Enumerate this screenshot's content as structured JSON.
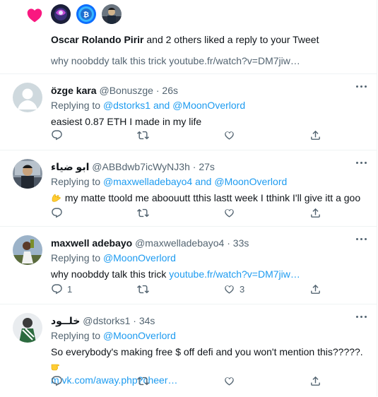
{
  "notification": {
    "actor": "Oscar Rolando Pirir",
    "action": "and 2 others liked a reply to your Tweet",
    "preview": "why  noobddy talk  this trick youtube.fr/watch?v=DM7jiw…"
  },
  "tweets": [
    {
      "name": "özge kara",
      "handle": "@Bonuszge",
      "sep": "·",
      "time": "26s",
      "reply_prefix": "Replying to ",
      "reply_to": "@dstorks1 and @MoonOverlord",
      "text": "easiest 0.87 ETH I made in my life",
      "reply_count": "",
      "like_count": ""
    },
    {
      "name": "ابو ضياء",
      "handle": "@ABBdwb7icWyNJ3h",
      "sep": "·",
      "time": "27s",
      "reply_prefix": "Replying to ",
      "reply_to": "@maxwelladebayo4 and @MoonOverlord",
      "text": "my matte ttoold me aboouutt tthis lastt week I tthink I'll give itt a goo",
      "reply_count": "",
      "like_count": ""
    },
    {
      "name": "maxwell adebayo",
      "handle": "@maxwelladebayo4",
      "sep": "·",
      "time": "33s",
      "reply_prefix": "Replying to ",
      "reply_to": "@MoonOverlord",
      "text": "why  noobddy talk  this trick ",
      "link": "youtube.fr/watch?v=DM7jiw…",
      "reply_count": "1",
      "like_count": "3"
    },
    {
      "name": "خلــود",
      "handle": "@dstorks1",
      "sep": "·",
      "time": "34s",
      "reply_prefix": "Replying to ",
      "reply_to": "@MoonOverlord",
      "text": "So everybody's making free $ off defi and you won't mention this?????.",
      "link": "m.vk.com/away.php?cheer…",
      "reply_count": "",
      "like_count": ""
    }
  ],
  "colors": {
    "accent": "#1d9bf0",
    "heart": "#f91880",
    "secondary_text": "#536471",
    "divider": "#eff3f4"
  },
  "icons": [
    "heart-icon",
    "reply-icon",
    "retweet-icon",
    "like-icon",
    "share-icon",
    "more-icon",
    "waving-hand-icon",
    "pointing-hand-icon"
  ]
}
